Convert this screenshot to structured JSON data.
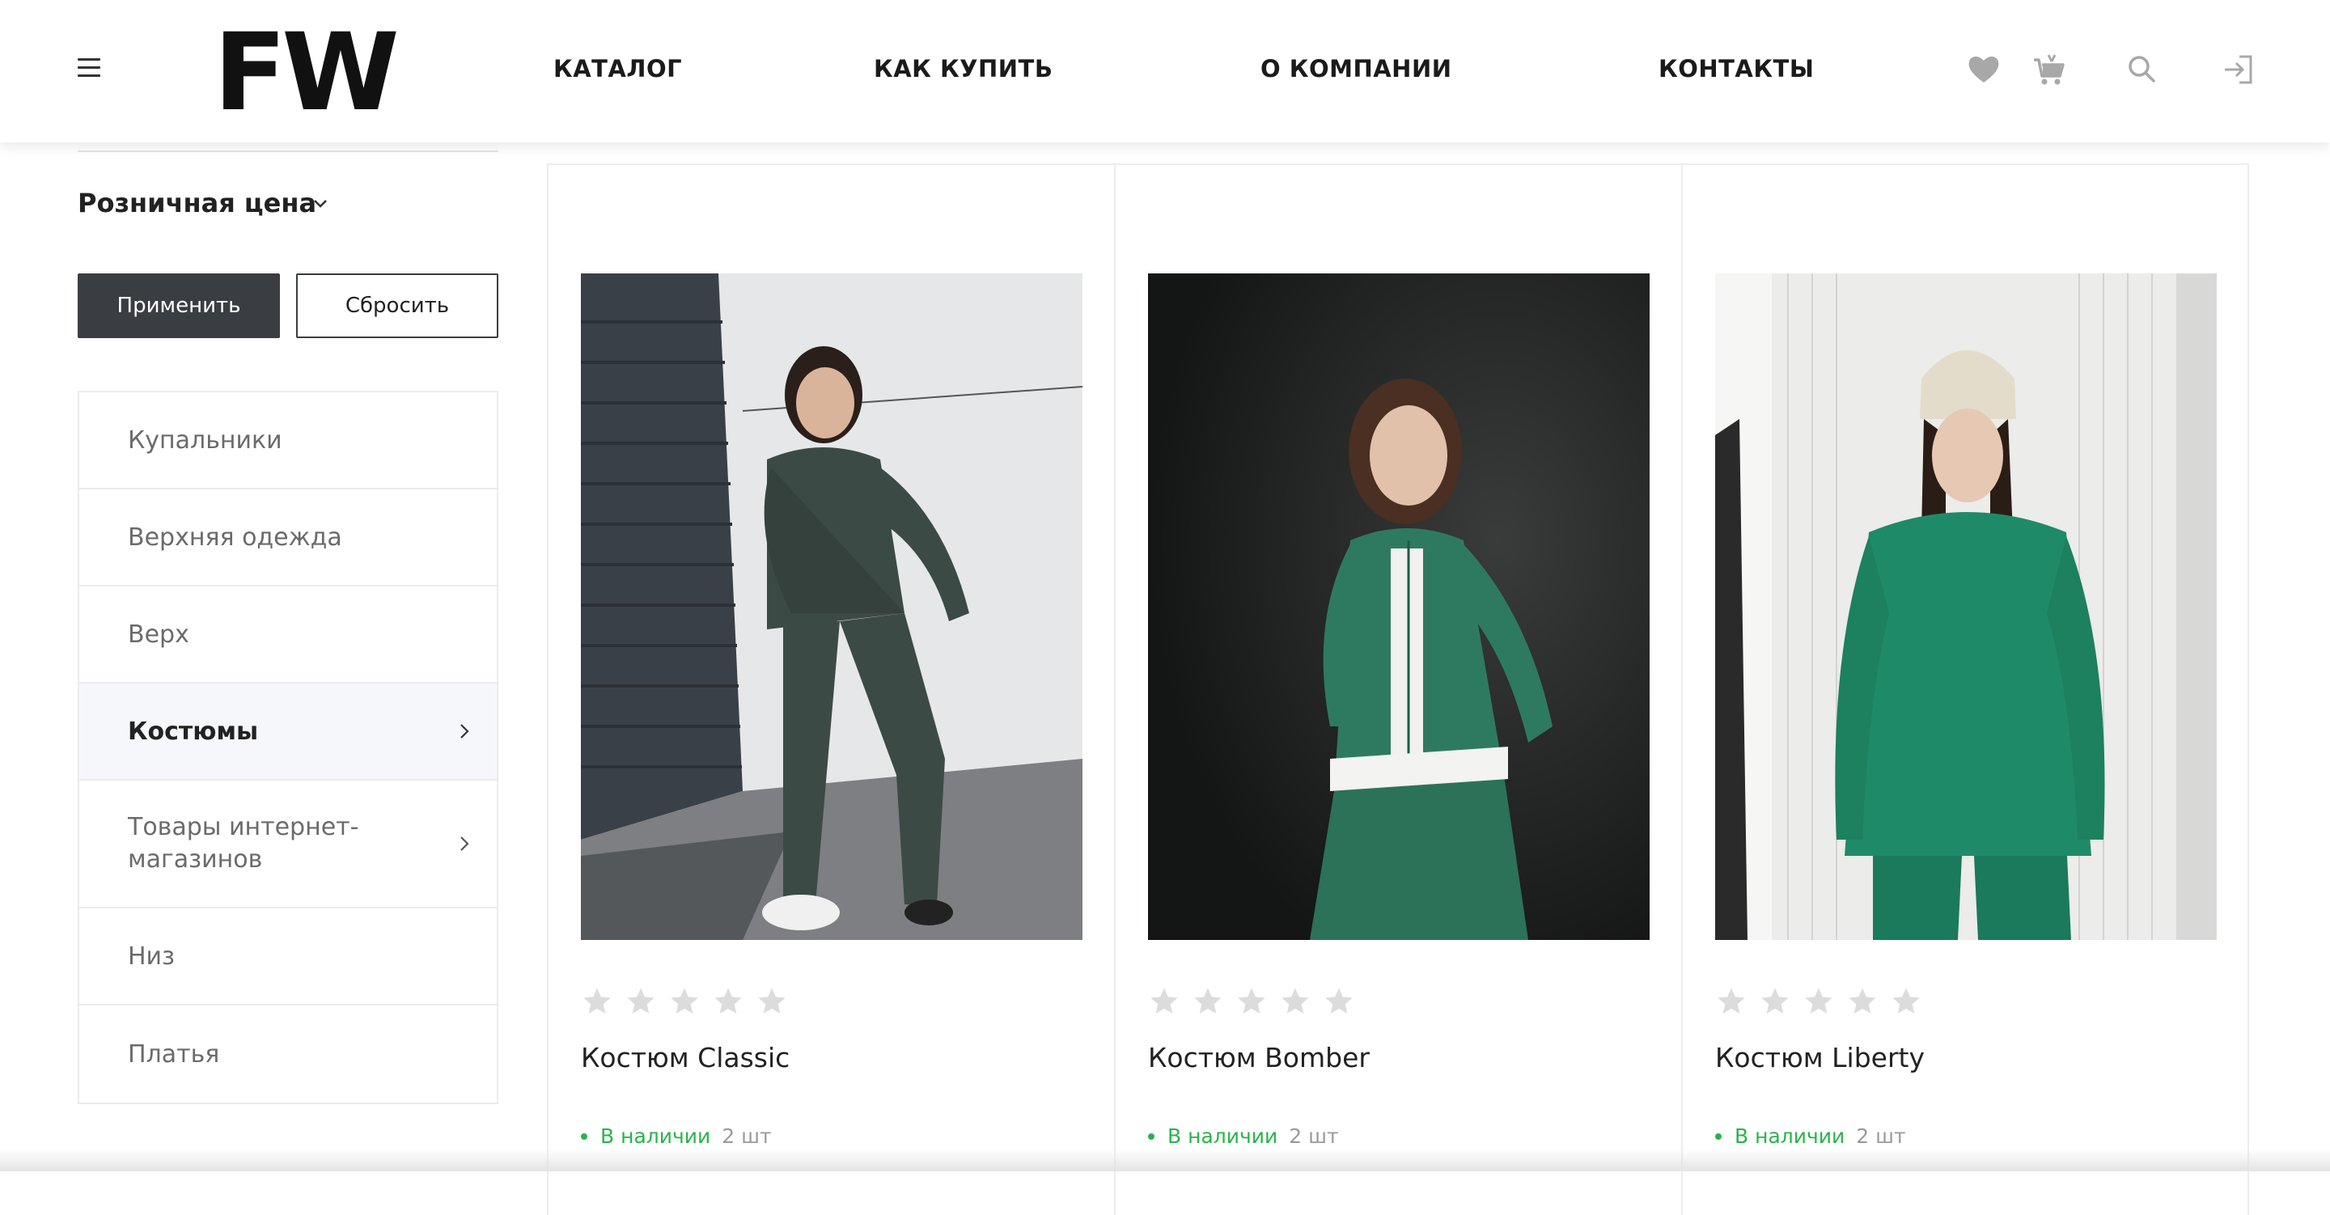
{
  "header": {
    "logo": "FW",
    "nav": [
      "КАТАЛОГ",
      "КАК КУПИТЬ",
      "О КОМПАНИИ",
      "КОНТАКТЫ"
    ],
    "icons": [
      "menu-icon",
      "heart-icon",
      "cart-icon",
      "search-icon",
      "login-icon"
    ]
  },
  "sidebar": {
    "price_filter_label": "Розничная цена",
    "apply_label": "Применить",
    "reset_label": "Сбросить",
    "categories": [
      {
        "label": "Купальники",
        "active": false,
        "has_children": false
      },
      {
        "label": "Верхняя одежда",
        "active": false,
        "has_children": false
      },
      {
        "label": "Верх",
        "active": false,
        "has_children": false
      },
      {
        "label": "Костюмы",
        "active": true,
        "has_children": true
      },
      {
        "label": "Товары интернет-магазинов",
        "active": false,
        "has_children": true
      },
      {
        "label": "Низ",
        "active": false,
        "has_children": false
      },
      {
        "label": "Платья",
        "active": false,
        "has_children": false
      }
    ]
  },
  "products": [
    {
      "name": "Костюм Classic",
      "rating": 0,
      "stock_label": "В наличии",
      "stock_qty": "2 шт"
    },
    {
      "name": "Костюм Bomber",
      "rating": 0,
      "stock_label": "В наличии",
      "stock_qty": "2 шт"
    },
    {
      "name": "Костюм Liberty",
      "rating": 0,
      "stock_label": "В наличии",
      "stock_qty": "2 шт"
    }
  ],
  "colors": {
    "primary_button": "#3a3d42",
    "in_stock": "#2bb24c",
    "star_empty": "#dcdcdc",
    "active_category_bg": "#f6f7fa"
  }
}
